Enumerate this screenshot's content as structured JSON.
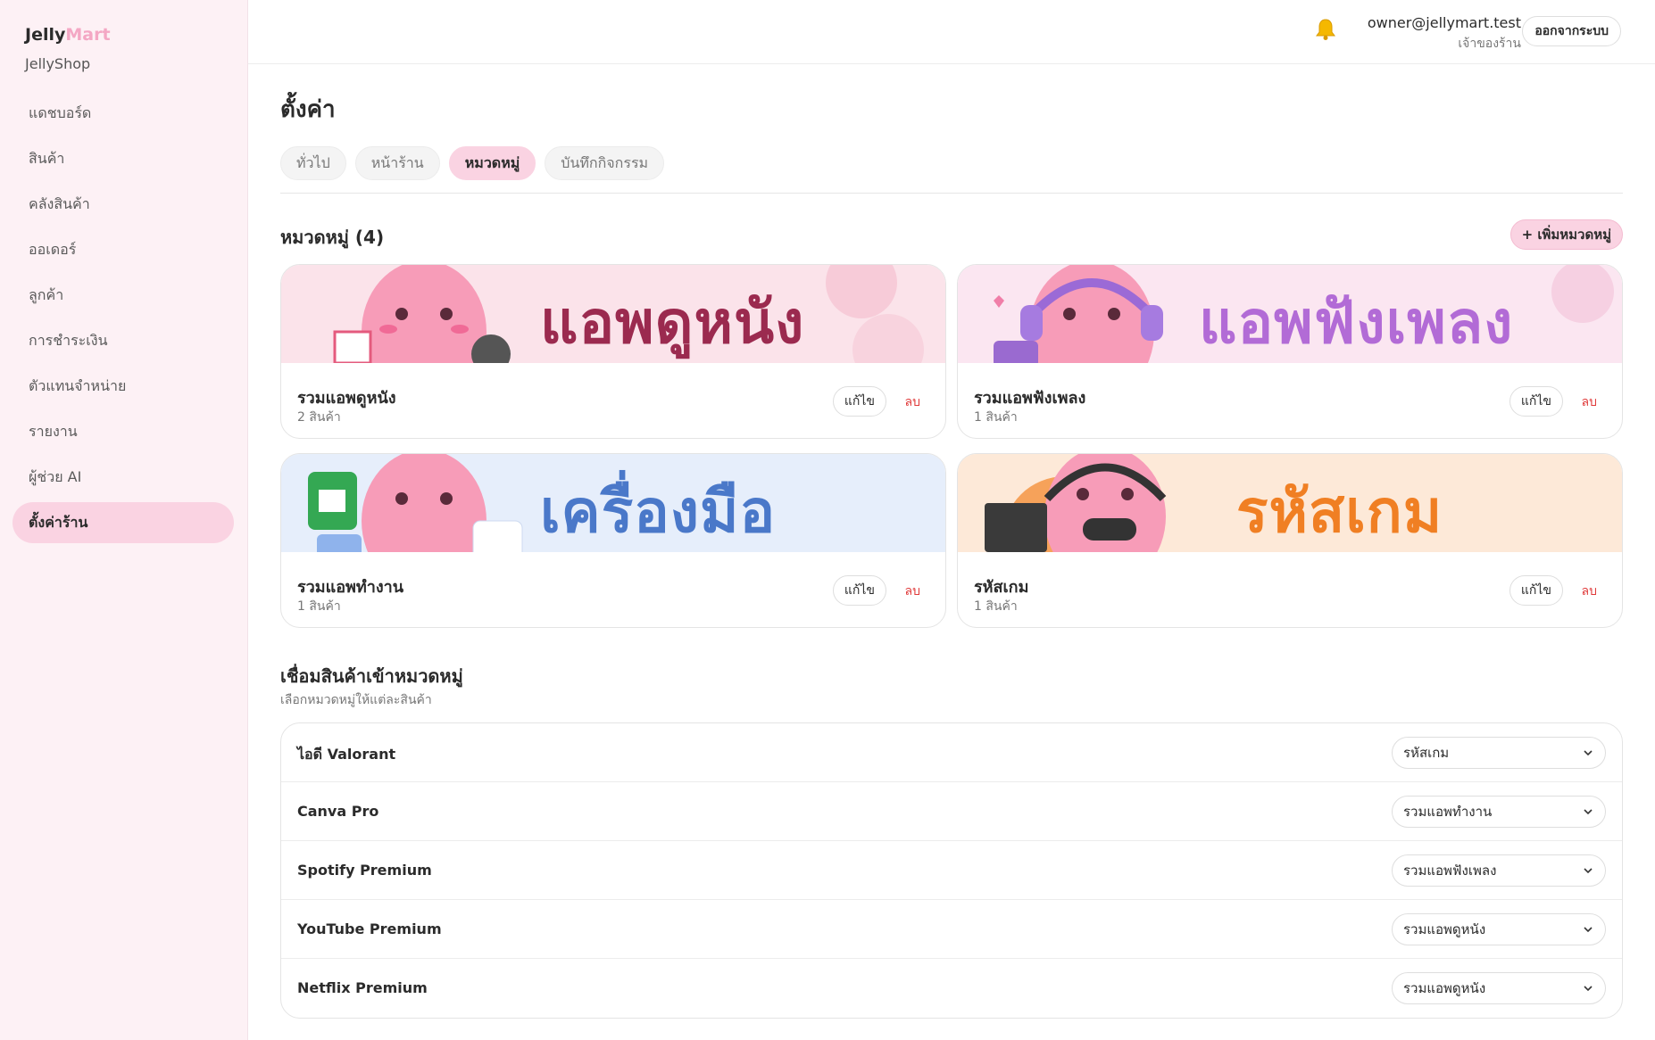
{
  "brand": {
    "part1": "Jelly",
    "part2": "Mart",
    "shop_name": "JellyShop"
  },
  "sidebar": {
    "items": [
      {
        "label": "แดชบอร์ด"
      },
      {
        "label": "สินค้า"
      },
      {
        "label": "คลังสินค้า"
      },
      {
        "label": "ออเดอร์"
      },
      {
        "label": "ลูกค้า"
      },
      {
        "label": "การชำระเงิน"
      },
      {
        "label": "ตัวแทนจำหน่าย"
      },
      {
        "label": "รายงาน"
      },
      {
        "label": "ผู้ช่วย AI"
      },
      {
        "label": "ตั้งค่าร้าน"
      }
    ],
    "active_index": 9
  },
  "header": {
    "icon": "bell-icon",
    "user_email": "owner@jellymart.test",
    "user_role": "เจ้าของร้าน",
    "logout_label": "ออกจากระบบ"
  },
  "page": {
    "title": "ตั้งค่า",
    "tabs": [
      {
        "label": "ทั่วไป"
      },
      {
        "label": "หน้าร้าน"
      },
      {
        "label": "หมวดหมู่"
      },
      {
        "label": "บันทึกกิจกรรม"
      }
    ],
    "active_tab": 2
  },
  "categories": {
    "title": "หมวดหมู่ (4)",
    "add_label": "+ เพิ่มหมวดหมู่",
    "edit_label": "แก้ไข",
    "delete_label": "ลบ",
    "items": [
      {
        "banner_text": "แอพดูหนัง",
        "name": "รวมแอพดูหนัง",
        "count": "2 สินค้า",
        "banner_color": "#9b2a4f",
        "banner_bg": "#fbe3ea"
      },
      {
        "banner_text": "แอพฟังเพลง",
        "name": "รวมแอพฟังเพลง",
        "count": "1 สินค้า",
        "banner_color": "#b26bd6",
        "banner_bg": "#fbe6f1"
      },
      {
        "banner_text": "เครื่องมือทำงาน",
        "name": "รวมแอพทำงาน",
        "count": "1 สินค้า",
        "banner_color": "#4a78c9",
        "banner_bg": "#e6eefb"
      },
      {
        "banner_text": "รหัสเกม",
        "name": "รหัสเกม",
        "count": "1 สินค้า",
        "banner_color": "#f07f23",
        "banner_bg": "#fde9d8"
      }
    ]
  },
  "link_section": {
    "title": "เชื่อมสินค้าเข้าหมวดหมู่",
    "subtitle": "เลือกหมวดหมู่ให้แต่ละสินค้า",
    "rows": [
      {
        "product": "ไอดี Valorant",
        "category": "รหัสเกม"
      },
      {
        "product": "Canva Pro",
        "category": "รวมแอพทำงาน"
      },
      {
        "product": "Spotify Premium",
        "category": "รวมแอพฟังเพลง"
      },
      {
        "product": "YouTube Premium",
        "category": "รวมแอพดูหนัง"
      },
      {
        "product": "Netflix Premium",
        "category": "รวมแอพดูหนัง"
      }
    ]
  }
}
